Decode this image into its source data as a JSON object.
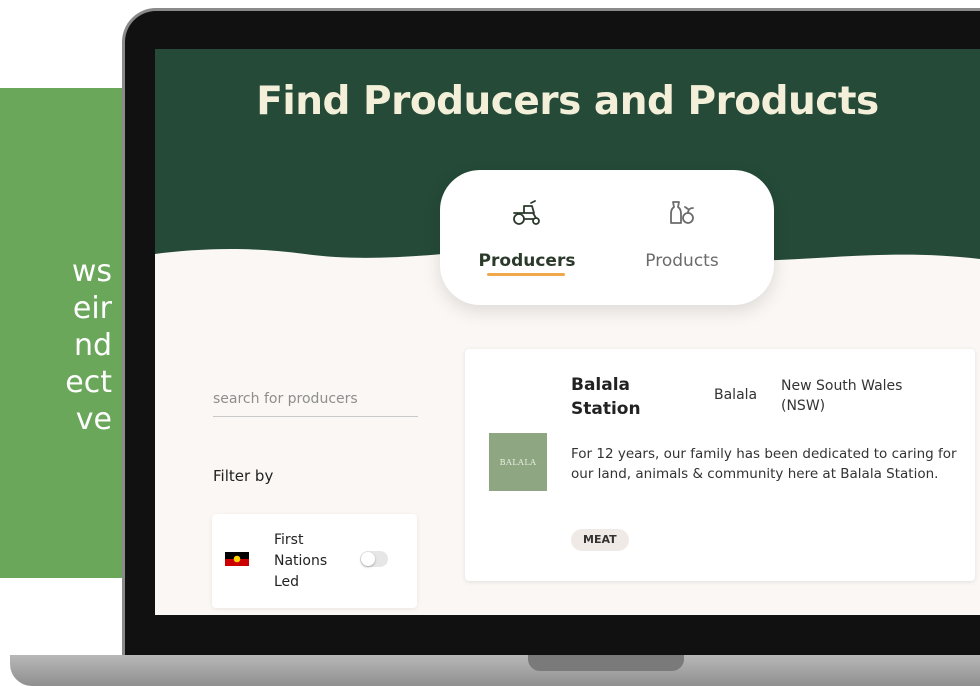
{
  "promo": {
    "lines": [
      "ws",
      "eir",
      "nd",
      "ect",
      "ve"
    ],
    "color": "#6aa75a"
  },
  "header": {
    "title": "Find Producers and Products",
    "color": "#254a38"
  },
  "tabs": [
    {
      "label": "Producers",
      "icon": "tractor-icon",
      "active": true
    },
    {
      "label": "Products",
      "icon": "produce-icon",
      "active": false
    }
  ],
  "sidebar": {
    "search_placeholder": "search for producers",
    "filter_label": "Filter by",
    "filters": [
      {
        "label": "First Nations Led",
        "icon": "aboriginal-flag-icon",
        "enabled": false
      }
    ]
  },
  "producer": {
    "name": "Balala Station",
    "town": "Balala",
    "state": "New South Wales (NSW)",
    "description": "For 12 years, our family has been dedicated to caring for our land, animals & community here at Balala Station.",
    "logo_text": "BALALA",
    "tag": "MEAT"
  },
  "colors": {
    "accent": "#f0a84a",
    "background": "#fbf7f4"
  }
}
